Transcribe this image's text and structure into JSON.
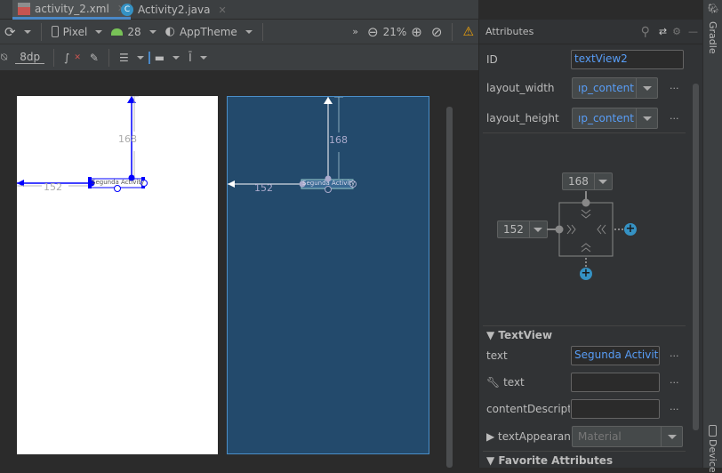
{
  "tabs": [
    {
      "label": "activity_2.xml",
      "icon": "layout-xml-icon",
      "active": true
    },
    {
      "label": "Activity2.java",
      "icon": "class-c-icon",
      "active": false
    }
  ],
  "toolbar1": {
    "device": "Pixel",
    "api": "28",
    "theme": "AppTheme",
    "zoom": "21%"
  },
  "toolbar2": {
    "margin": "8dp"
  },
  "design": {
    "textview_text": "Segunda Activity",
    "margin_top": "168",
    "margin_left": "152"
  },
  "attributes": {
    "title": "Attributes",
    "id_label": "ID",
    "id_value": "textView2",
    "layout_width_label": "layout_width",
    "layout_width_value": "ıp_content",
    "layout_height_label": "layout_height",
    "layout_height_value": "ıp_content",
    "constraint": {
      "top": "168",
      "left": "152"
    },
    "textview_section": "TextView",
    "text_label": "text",
    "text_value": "Segunda Activity",
    "tools_text_label": "text",
    "tools_text_value": "",
    "content_desc_label": "contentDescriptic",
    "content_desc_value": "",
    "text_appearance_label": "textAppearanc",
    "text_appearance_value": "Material",
    "favorite_section": "Favorite Attributes"
  },
  "side": {
    "gradle": "Gradle",
    "device": "Device"
  },
  "colors": {
    "accent": "#4a88c7",
    "link": "#589df6",
    "blueprint": "#234a6c",
    "constraint": "#0000ff",
    "warning": "#f0a30a",
    "add": "#3592c4"
  }
}
